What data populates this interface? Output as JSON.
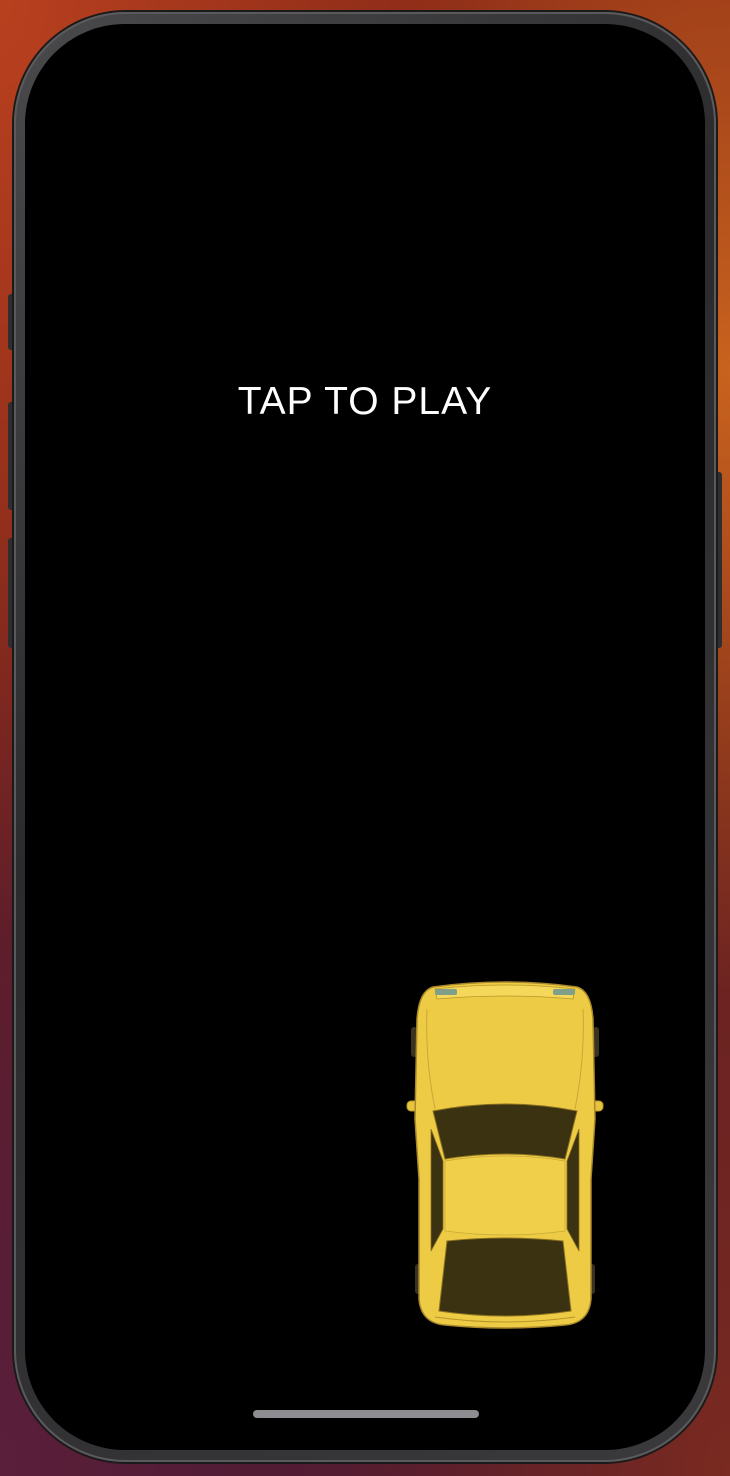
{
  "game": {
    "prompt_text": "TAP TO PLAY",
    "player_car": {
      "color": "#eecb44",
      "icon": "yellow-car-top-view"
    },
    "background_color": "#000000"
  },
  "device": {
    "home_indicator": "home-indicator-bar"
  }
}
